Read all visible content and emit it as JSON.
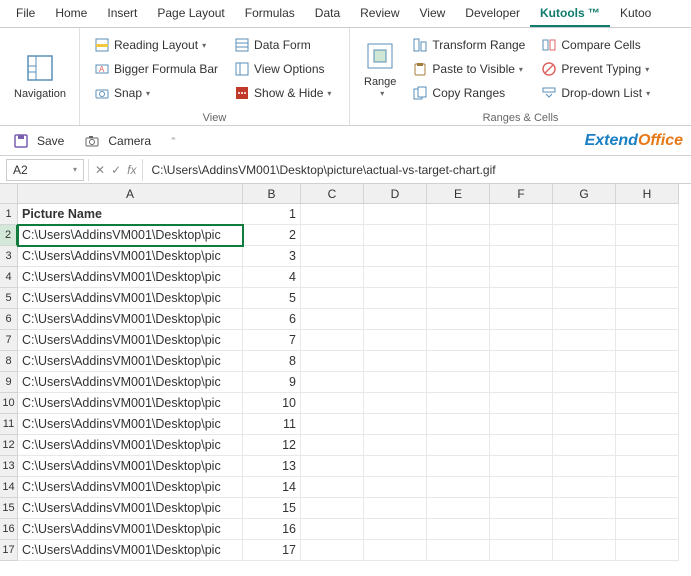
{
  "tabs": [
    "File",
    "Home",
    "Insert",
    "Page Layout",
    "Formulas",
    "Data",
    "Review",
    "View",
    "Developer",
    "Kutools ™",
    "Kutoo"
  ],
  "activeTab": 9,
  "ribbon": {
    "navigation": "Navigation",
    "readingLayout": "Reading Layout",
    "biggerFormula": "Bigger Formula Bar",
    "snap": "Snap",
    "dataForm": "Data Form",
    "viewOptions": "View Options",
    "showHide": "Show & Hide",
    "groupView": "View",
    "range": "Range",
    "transformRange": "Transform Range",
    "pasteVisible": "Paste to Visible",
    "copyRanges": "Copy Ranges",
    "compareCells": "Compare Cells",
    "preventTyping": "Prevent Typing",
    "dropdownList": "Drop-down List",
    "groupRanges": "Ranges & Cells"
  },
  "qat": {
    "save": "Save",
    "camera": "Camera"
  },
  "brand": {
    "a": "Extend",
    "b": "Office"
  },
  "formulaBar": {
    "nameBox": "A2",
    "fx": "fx",
    "value": "C:\\Users\\AddinsVM001\\Desktop\\picture\\actual-vs-target-chart.gif"
  },
  "columns": [
    "A",
    "B",
    "C",
    "D",
    "E",
    "F",
    "G",
    "H"
  ],
  "rows": [
    {
      "n": 1,
      "A": "Picture Name",
      "B": "1"
    },
    {
      "n": 2,
      "A": "C:\\Users\\AddinsVM001\\Desktop\\pic",
      "B": "2",
      "selected": true
    },
    {
      "n": 3,
      "A": "C:\\Users\\AddinsVM001\\Desktop\\pic",
      "B": "3"
    },
    {
      "n": 4,
      "A": "C:\\Users\\AddinsVM001\\Desktop\\pic",
      "B": "4"
    },
    {
      "n": 5,
      "A": "C:\\Users\\AddinsVM001\\Desktop\\pic",
      "B": "5"
    },
    {
      "n": 6,
      "A": "C:\\Users\\AddinsVM001\\Desktop\\pic",
      "B": "6"
    },
    {
      "n": 7,
      "A": "C:\\Users\\AddinsVM001\\Desktop\\pic",
      "B": "7"
    },
    {
      "n": 8,
      "A": "C:\\Users\\AddinsVM001\\Desktop\\pic",
      "B": "8"
    },
    {
      "n": 9,
      "A": "C:\\Users\\AddinsVM001\\Desktop\\pic",
      "B": "9"
    },
    {
      "n": 10,
      "A": "C:\\Users\\AddinsVM001\\Desktop\\pic",
      "B": "10"
    },
    {
      "n": 11,
      "A": "C:\\Users\\AddinsVM001\\Desktop\\pic",
      "B": "11"
    },
    {
      "n": 12,
      "A": "C:\\Users\\AddinsVM001\\Desktop\\pic",
      "B": "12"
    },
    {
      "n": 13,
      "A": "C:\\Users\\AddinsVM001\\Desktop\\pic",
      "B": "13"
    },
    {
      "n": 14,
      "A": "C:\\Users\\AddinsVM001\\Desktop\\pic",
      "B": "14"
    },
    {
      "n": 15,
      "A": "C:\\Users\\AddinsVM001\\Desktop\\pic",
      "B": "15"
    },
    {
      "n": 16,
      "A": "C:\\Users\\AddinsVM001\\Desktop\\pic",
      "B": "16"
    },
    {
      "n": 17,
      "A": "C:\\Users\\AddinsVM001\\Desktop\\pic",
      "B": "17"
    }
  ]
}
